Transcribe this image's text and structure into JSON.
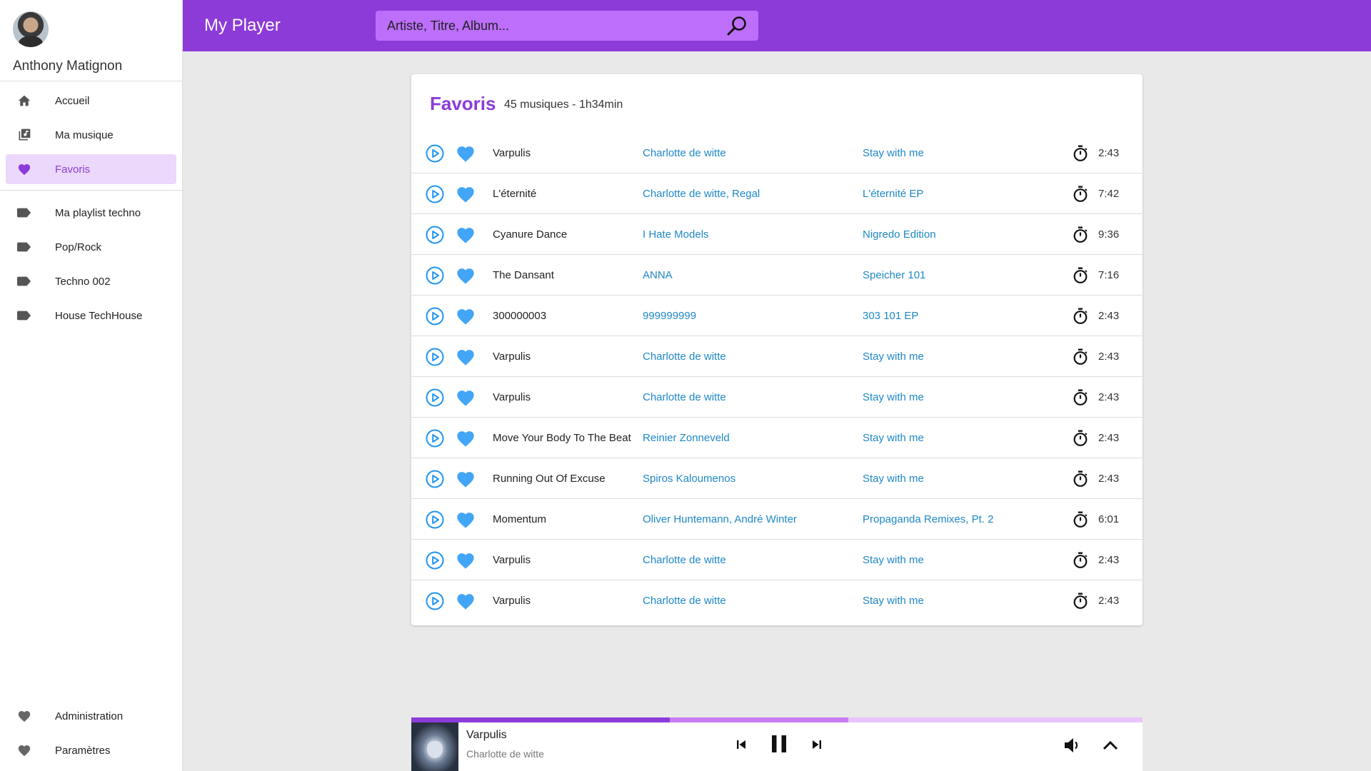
{
  "app": {
    "title": "My Player"
  },
  "search": {
    "placeholder": "Artiste, Titre, Album..."
  },
  "user": {
    "name": "Anthony Matignon"
  },
  "sidebar": {
    "main": [
      {
        "label": "Accueil",
        "icon": "home-icon"
      },
      {
        "label": "Ma musique",
        "icon": "library-music-icon"
      },
      {
        "label": "Favoris",
        "icon": "heart-icon",
        "active": true
      }
    ],
    "playlists": [
      {
        "label": "Ma playlist techno",
        "icon": "label-icon"
      },
      {
        "label": "Pop/Rock",
        "icon": "label-icon"
      },
      {
        "label": "Techno 002",
        "icon": "label-icon"
      },
      {
        "label": "House TechHouse",
        "icon": "label-icon"
      }
    ],
    "bottom": [
      {
        "label": "Administration",
        "icon": "heart-icon"
      },
      {
        "label": "Paramètres",
        "icon": "heart-icon"
      }
    ]
  },
  "favorites": {
    "title": "Favoris",
    "summary": "45 musiques - 1h34min",
    "tracks": [
      {
        "title": "Varpulis",
        "artist": "Charlotte de witte",
        "album": "Stay with me",
        "duration": "2:43"
      },
      {
        "title": "L'éternité",
        "artist": "Charlotte de witte, Regal",
        "album": "L'éternité EP",
        "duration": "7:42"
      },
      {
        "title": "Cyanure Dance",
        "artist": "I Hate Models",
        "album": "Nigredo Edition",
        "duration": "9:36"
      },
      {
        "title": "The Dansant",
        "artist": "ANNA",
        "album": "Speicher 101",
        "duration": "7:16"
      },
      {
        "title": "300000003",
        "artist": "999999999",
        "album": "303 101 EP",
        "duration": "2:43"
      },
      {
        "title": "Varpulis",
        "artist": "Charlotte de witte",
        "album": "Stay with me",
        "duration": "2:43"
      },
      {
        "title": "Varpulis",
        "artist": "Charlotte de witte",
        "album": "Stay with me",
        "duration": "2:43"
      },
      {
        "title": "Move Your  Body To The Beat",
        "artist": "Reinier Zonneveld",
        "album": "Stay with me",
        "duration": "2:43"
      },
      {
        "title": "Running Out Of Excuse",
        "artist": "Spiros Kaloumenos",
        "album": "Stay with me",
        "duration": "2:43"
      },
      {
        "title": "Momentum",
        "artist": "Oliver Huntemann, André Winter",
        "album": "Propaganda Remixes, Pt. 2",
        "duration": "6:01"
      },
      {
        "title": "Varpulis",
        "artist": "Charlotte de witte",
        "album": "Stay with me",
        "duration": "2:43"
      },
      {
        "title": "Varpulis",
        "artist": "Charlotte de witte",
        "album": "Stay with me",
        "duration": "2:43"
      }
    ]
  },
  "player": {
    "title": "Varpulis",
    "artist": "Charlotte de witte",
    "progress": 0.354,
    "buffered": 0.598
  },
  "colors": {
    "brand": "#8c3bd9",
    "search_bg": "#bd6efb",
    "link": "#1e88c7",
    "heart": "#42a5f5",
    "active_bg": "#ecd8fb"
  }
}
